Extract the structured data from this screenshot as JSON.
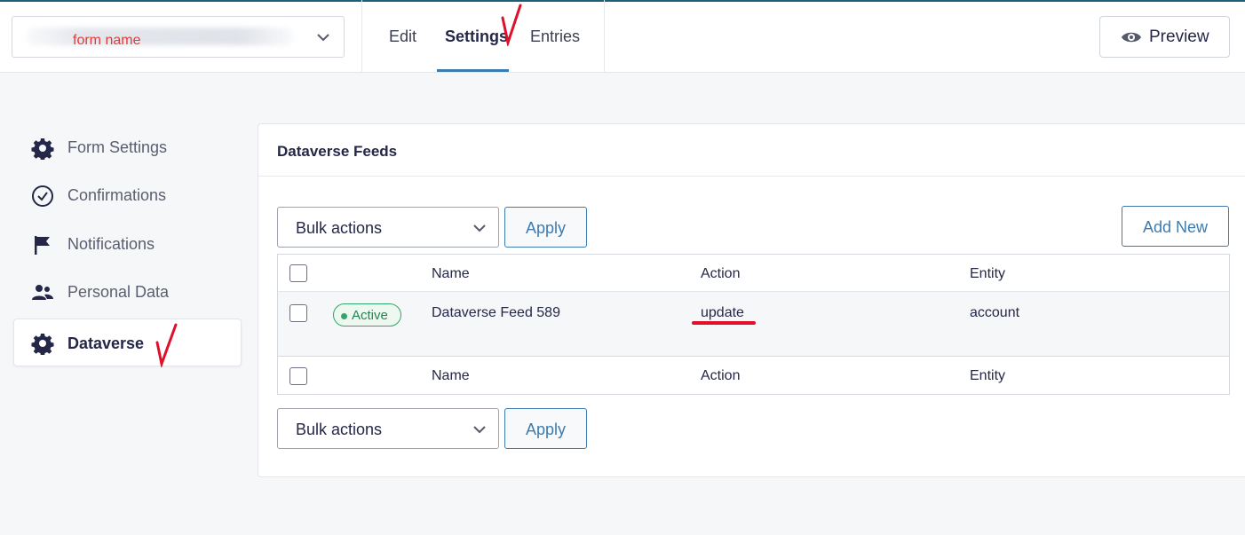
{
  "header": {
    "form_selector": {
      "value_annotation": "form name"
    },
    "tabs": [
      {
        "label": "Edit"
      },
      {
        "label": "Settings",
        "active": true
      },
      {
        "label": "Entries"
      }
    ],
    "preview_label": "Preview"
  },
  "sidebar": {
    "items": [
      {
        "label": "Form Settings",
        "icon": "gear-icon"
      },
      {
        "label": "Confirmations",
        "icon": "check-circle-icon"
      },
      {
        "label": "Notifications",
        "icon": "flag-icon"
      },
      {
        "label": "Personal Data",
        "icon": "users-icon"
      },
      {
        "label": "Dataverse",
        "icon": "gear-icon",
        "active": true
      }
    ]
  },
  "main": {
    "title": "Dataverse Feeds",
    "bulk_actions_label": "Bulk actions",
    "apply_label": "Apply",
    "add_new_label": "Add New",
    "table": {
      "columns": [
        "Name",
        "Action",
        "Entity"
      ],
      "rows": [
        {
          "status": "Active",
          "name": "Dataverse Feed 589",
          "action": "update",
          "entity": "account"
        }
      ]
    }
  },
  "colors": {
    "accent": "#3c7bb0",
    "active_green": "#30a66b",
    "annotation_red": "#e0102a"
  }
}
